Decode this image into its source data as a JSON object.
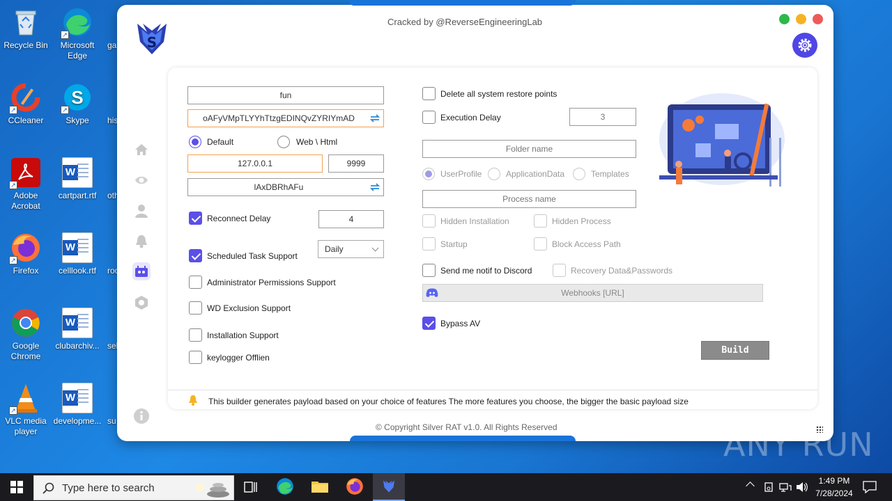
{
  "desktop": {
    "icons": [
      {
        "label": "Recycle Bin"
      },
      {
        "label": "Microsoft Edge"
      },
      {
        "label": "ga"
      },
      {
        "label": "CCleaner"
      },
      {
        "label": "Skype"
      },
      {
        "label": "his"
      },
      {
        "label": "Adobe Acrobat"
      },
      {
        "label": "cartpart.rtf"
      },
      {
        "label": "othe"
      },
      {
        "label": "Firefox"
      },
      {
        "label": "celllook.rtf"
      },
      {
        "label": "room"
      },
      {
        "label": "Google Chrome"
      },
      {
        "label": "clubarchiv..."
      },
      {
        "label": "sel"
      },
      {
        "label": "VLC media player"
      },
      {
        "label": "developme..."
      },
      {
        "label": "su"
      }
    ]
  },
  "window": {
    "title": "Cracked by @ReverseEngineeringLab",
    "controls": {
      "colors": [
        "#2db84c",
        "#f5b324",
        "#ee5a5a"
      ]
    },
    "accent": "#5b4fe8"
  },
  "left": {
    "name_value": "fun",
    "key_value": "oAFyVMpTLYYhTtzgEDINQvZYRIYmAD",
    "radio_default": "Default",
    "radio_web": "Web \\ Html",
    "host": "127.0.0.1",
    "port": "9999",
    "mutex": "lAxDBRhAFu",
    "reconnect_delay_label": "Reconnect Delay",
    "reconnect_delay_value": "4",
    "scheduled_task_label": "Scheduled Task Support",
    "schedule_option": "Daily",
    "admin_label": "Administrator Permissions Support",
    "wd_label": "WD Exclusion Support",
    "install_label": "Installation Support",
    "keylogger_label": "keylogger Offlien"
  },
  "right": {
    "restore_label": "Delete all system restore points",
    "exec_delay_label": "Execution Delay",
    "exec_delay_value": "3",
    "folder_placeholder": "Folder name",
    "radio_userprofile": "UserProfile",
    "radio_appdata": "ApplicationData",
    "radio_templates": "Templates",
    "process_placeholder": "Process name",
    "hidden_install": "Hidden Installation",
    "hidden_process": "Hidden Process",
    "startup": "Startup",
    "block_access": "Block Access Path",
    "discord_label": "Send me notif to Discord",
    "recovery_label": "Recovery Data&Passwords",
    "webhooks_placeholder": "Webhooks [URL]",
    "bypass_label": "Bypass AV",
    "build_label": "Build"
  },
  "footer": {
    "notice": "This builder generates payload based on your choice of features The more features you choose, the bigger the basic payload size",
    "copyright": "© Copyright Silver RAT v1.0. All Rights Reserved"
  },
  "taskbar": {
    "search_placeholder": "Type here to search",
    "time": "1:49 PM",
    "date": "7/28/2024"
  },
  "watermark": "ANY RUN"
}
